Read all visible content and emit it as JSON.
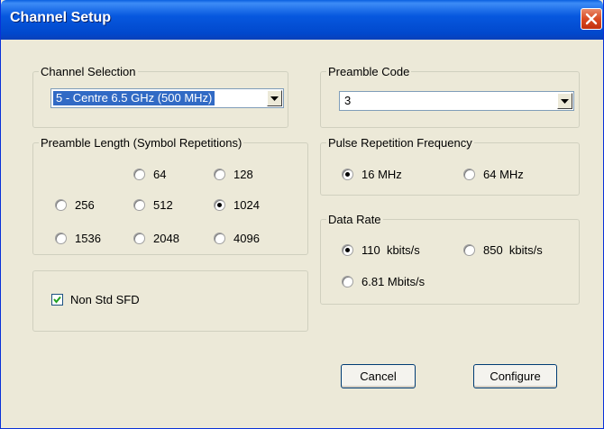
{
  "window": {
    "title": "Channel Setup"
  },
  "channel_selection": {
    "legend": "Channel Selection",
    "selected": "5 - Centre 6.5 GHz (500 MHz)"
  },
  "preamble_code": {
    "legend": "Preamble Code",
    "selected": "3"
  },
  "preamble_length": {
    "legend": "Preamble Length (Symbol Repetitions)",
    "options": [
      "64",
      "128",
      "256",
      "512",
      "1024",
      "1536",
      "2048",
      "4096"
    ],
    "selected": "1024"
  },
  "prf": {
    "legend": "Pulse Repetition Frequency",
    "options": [
      "16 MHz",
      "64 MHz"
    ],
    "selected": "16 MHz"
  },
  "data_rate": {
    "legend": "Data Rate",
    "options": [
      "110  kbits/s",
      "850  kbits/s",
      "6.81 Mbits/s"
    ],
    "selected": "110  kbits/s"
  },
  "non_std_sfd": {
    "label": "Non Std SFD",
    "checked": true
  },
  "buttons": {
    "cancel": "Cancel",
    "configure": "Configure"
  }
}
